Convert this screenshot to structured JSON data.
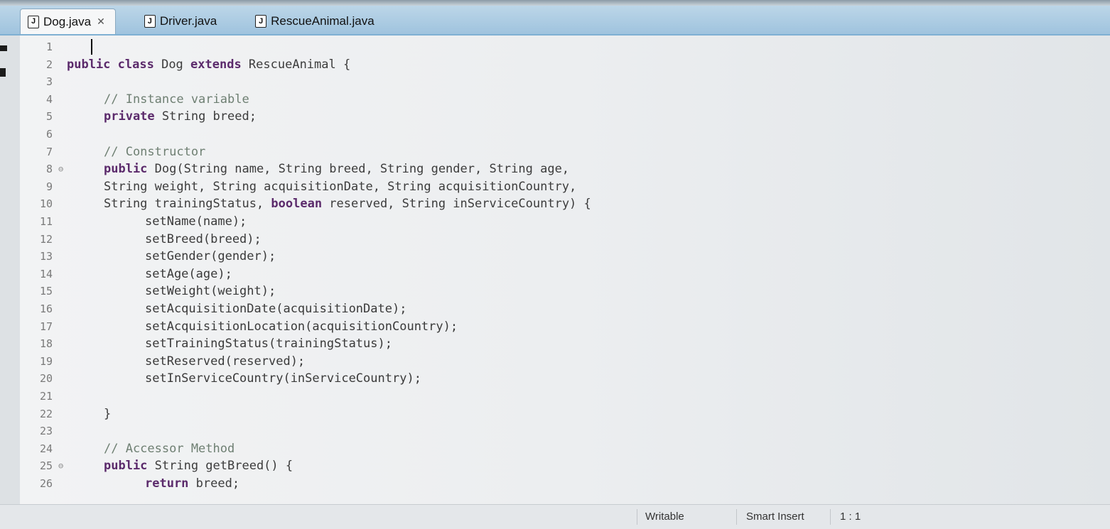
{
  "tabs": [
    {
      "label": "Dog.java",
      "active": true
    },
    {
      "label": "Driver.java",
      "active": false
    },
    {
      "label": "RescueAnimal.java",
      "active": false
    }
  ],
  "tab_close_glyph": "✕",
  "file_icon_glyph": "J",
  "code_lines": [
    {
      "n": "1",
      "fold": "",
      "indent": 0,
      "segments": []
    },
    {
      "n": "2",
      "fold": "",
      "indent": 0,
      "segments": [
        {
          "t": "public ",
          "c": "kw"
        },
        {
          "t": "class ",
          "c": "kw"
        },
        {
          "t": "Dog ",
          "c": ""
        },
        {
          "t": "extends ",
          "c": "kw"
        },
        {
          "t": "RescueAnimal {",
          "c": ""
        }
      ]
    },
    {
      "n": "3",
      "fold": "",
      "indent": 0,
      "segments": []
    },
    {
      "n": "4",
      "fold": "",
      "indent": 1,
      "segments": [
        {
          "t": "// Instance variable",
          "c": "cm"
        }
      ]
    },
    {
      "n": "5",
      "fold": "",
      "indent": 1,
      "segments": [
        {
          "t": "private ",
          "c": "kw"
        },
        {
          "t": "String breed;",
          "c": ""
        }
      ]
    },
    {
      "n": "6",
      "fold": "",
      "indent": 0,
      "segments": []
    },
    {
      "n": "7",
      "fold": "",
      "indent": 1,
      "segments": [
        {
          "t": "// Constructor",
          "c": "cm"
        }
      ]
    },
    {
      "n": "8",
      "fold": "⊖",
      "indent": 1,
      "segments": [
        {
          "t": "public ",
          "c": "kw"
        },
        {
          "t": "Dog(String name, String breed, String gender, String age,",
          "c": ""
        }
      ]
    },
    {
      "n": "9",
      "fold": "",
      "indent": 1,
      "segments": [
        {
          "t": "String weight, String acquisitionDate, String acquisitionCountry,",
          "c": ""
        }
      ]
    },
    {
      "n": "10",
      "fold": "",
      "indent": 1,
      "segments": [
        {
          "t": "String trainingStatus, ",
          "c": ""
        },
        {
          "t": "boolean ",
          "c": "kw"
        },
        {
          "t": "reserved, String inServiceCountry) {",
          "c": ""
        }
      ]
    },
    {
      "n": "11",
      "fold": "",
      "indent": 2,
      "segments": [
        {
          "t": "setName(name);",
          "c": "mth"
        }
      ]
    },
    {
      "n": "12",
      "fold": "",
      "indent": 2,
      "segments": [
        {
          "t": "setBreed(breed);",
          "c": "mth"
        }
      ]
    },
    {
      "n": "13",
      "fold": "",
      "indent": 2,
      "segments": [
        {
          "t": "setGender(gender);",
          "c": "mth"
        }
      ]
    },
    {
      "n": "14",
      "fold": "",
      "indent": 2,
      "segments": [
        {
          "t": "setAge(age);",
          "c": "mth"
        }
      ]
    },
    {
      "n": "15",
      "fold": "",
      "indent": 2,
      "segments": [
        {
          "t": "setWeight(weight);",
          "c": "mth"
        }
      ]
    },
    {
      "n": "16",
      "fold": "",
      "indent": 2,
      "segments": [
        {
          "t": "setAcquisitionDate(acquisitionDate);",
          "c": "mth"
        }
      ]
    },
    {
      "n": "17",
      "fold": "",
      "indent": 2,
      "segments": [
        {
          "t": "setAcquisitionLocation(acquisitionCountry);",
          "c": "mth"
        }
      ]
    },
    {
      "n": "18",
      "fold": "",
      "indent": 2,
      "segments": [
        {
          "t": "setTrainingStatus(trainingStatus);",
          "c": "mth"
        }
      ]
    },
    {
      "n": "19",
      "fold": "",
      "indent": 2,
      "segments": [
        {
          "t": "setReserved(reserved);",
          "c": "mth"
        }
      ]
    },
    {
      "n": "20",
      "fold": "",
      "indent": 2,
      "segments": [
        {
          "t": "setInServiceCountry(inServiceCountry);",
          "c": "mth"
        }
      ]
    },
    {
      "n": "21",
      "fold": "",
      "indent": 0,
      "segments": []
    },
    {
      "n": "22",
      "fold": "",
      "indent": 1,
      "segments": [
        {
          "t": "}",
          "c": ""
        }
      ]
    },
    {
      "n": "23",
      "fold": "",
      "indent": 0,
      "segments": []
    },
    {
      "n": "24",
      "fold": "",
      "indent": 1,
      "segments": [
        {
          "t": "// Accessor Method",
          "c": "cm"
        }
      ]
    },
    {
      "n": "25",
      "fold": "⊖",
      "indent": 1,
      "segments": [
        {
          "t": "public ",
          "c": "kw"
        },
        {
          "t": "String getBreed() {",
          "c": ""
        }
      ]
    },
    {
      "n": "26",
      "fold": "",
      "indent": 2,
      "segments": [
        {
          "t": "return ",
          "c": "kw"
        },
        {
          "t": "breed;",
          "c": ""
        }
      ]
    }
  ],
  "status": {
    "writable": "Writable",
    "insert_mode": "Smart Insert",
    "position": "1 : 1"
  }
}
